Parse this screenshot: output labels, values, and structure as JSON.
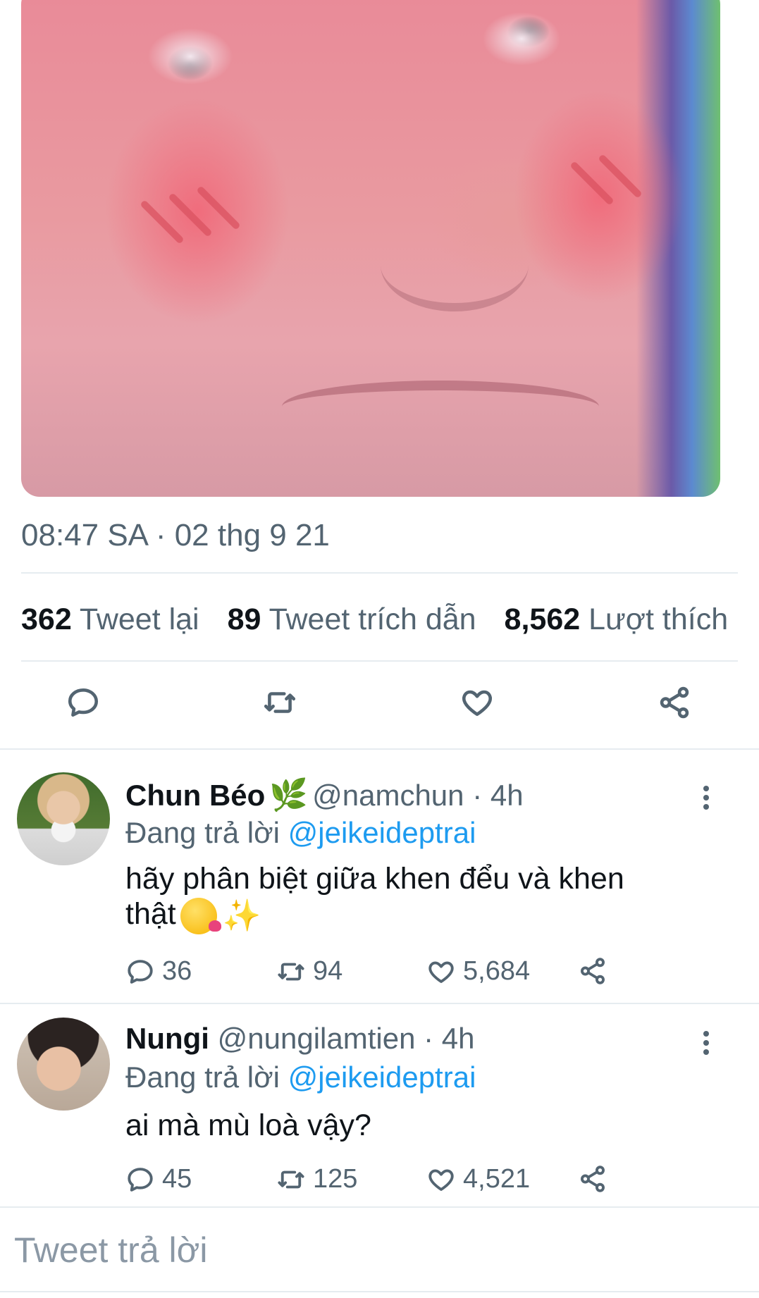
{
  "tweet": {
    "timestamp": "08:47 SA · 02 thg 9 21",
    "stats": [
      {
        "count": "362",
        "label": "Tweet lại"
      },
      {
        "count": "89",
        "label": "Tweet trích dẫn"
      },
      {
        "count": "8,562",
        "label": "Lượt thích"
      }
    ],
    "actions": [
      "reply-icon",
      "retweet-icon",
      "like-icon",
      "share-icon"
    ]
  },
  "replies": [
    {
      "name": "Chun Béo",
      "name_emoji": "🌿",
      "handle": "@namchun",
      "time": "4h",
      "replying_prefix": "Đang trả lời",
      "replying_to": "@jeikeideptrai",
      "text_line1": "hãy phân biệt giữa khen đểu và khen",
      "text_line2": "thật",
      "replies": "36",
      "retweets": "94",
      "likes": "5,684"
    },
    {
      "name": "Nungi",
      "handle": "@nungilamtien",
      "time": "4h",
      "replying_prefix": "Đang trả lời",
      "replying_to": "@jeikeideptrai",
      "text_line1": "ai mà mù loà vậy?",
      "replies": "45",
      "retweets": "125",
      "likes": "4,521"
    }
  ],
  "compose": {
    "placeholder": "Tweet trả lời"
  },
  "colors": {
    "accent": "#1d9bf0",
    "muted": "#536471",
    "divider": "#e6ecf0"
  }
}
